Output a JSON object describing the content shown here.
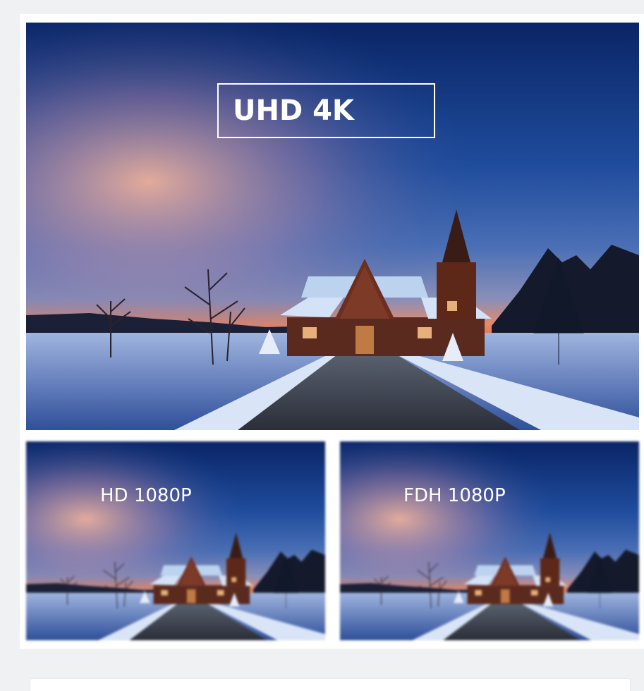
{
  "panels": {
    "main": {
      "label": "UHD 4K"
    },
    "left": {
      "label": "HD 1080P"
    },
    "right": {
      "label": "FDH 1080P"
    }
  },
  "colors": {
    "sky_top": "#0b2a6b",
    "sky_mid": "#2c5fb0",
    "sunset": "#f0805a",
    "snow": "#c9d6ef",
    "page_bg": "#f0f1f3"
  }
}
